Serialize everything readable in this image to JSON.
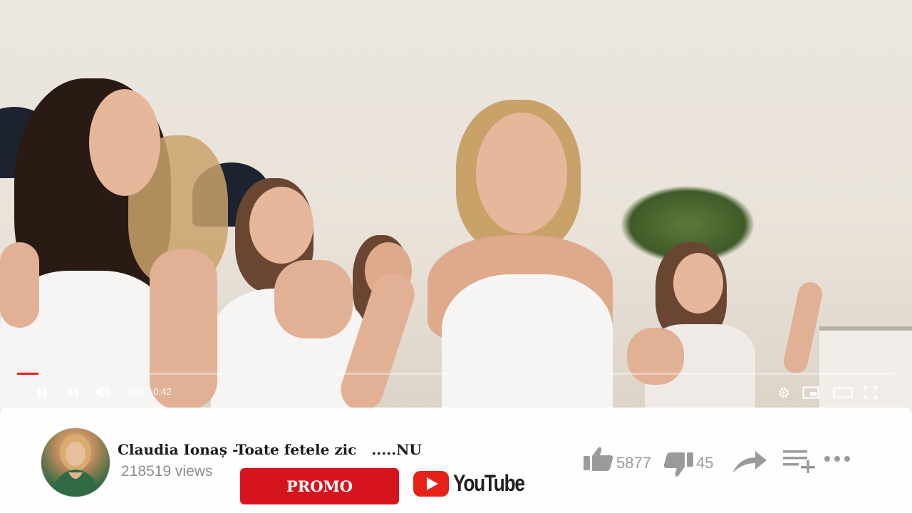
{
  "player": {
    "time_display": "0:01 / 0:42",
    "progress_fraction": 0.024,
    "accent_color": "#e62117"
  },
  "video": {
    "title": "Claudia Ionaș -Toate fetele zic   .....NU",
    "views": "218519 views",
    "promo_label": "PROMO",
    "youtube_wordmark": "YouTube",
    "brand_color": "#d6141d",
    "likes": "5877",
    "dislikes": "45"
  },
  "icons": {
    "controls_left": [
      "pause-icon",
      "next-icon",
      "volume-icon"
    ],
    "controls_right": [
      "settings-icon",
      "miniplayer-icon",
      "theater-icon",
      "fullscreen-icon"
    ],
    "actions": [
      "thumbs-up-icon",
      "thumbs-down-icon",
      "share-icon",
      "add-to-playlist-icon",
      "more-icon"
    ]
  }
}
